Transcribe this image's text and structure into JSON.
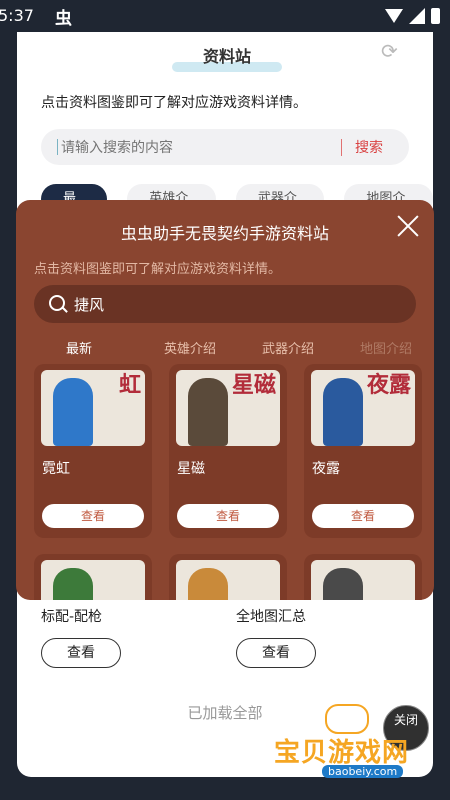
{
  "status": {
    "time": "5:37",
    "notif": "虫"
  },
  "page": {
    "title": "资料站",
    "desc": "点击资料图鉴即可了解对应游戏资料详情。",
    "search_placeholder": "请输入搜索的内容",
    "search_btn": "搜索",
    "tabs": [
      "最新",
      "英雄介绍",
      "武器介绍",
      "地图介绍"
    ],
    "bottom_items": [
      {
        "label": "标配-配枪",
        "btn": "查看"
      },
      {
        "label": "全地图汇总",
        "btn": "查看"
      }
    ],
    "loaded": "已加载全部"
  },
  "modal": {
    "title": "虫虫助手无畏契约手游资料站",
    "desc": "点击资料图鉴即可了解对应游戏资料详情。",
    "query": "捷风",
    "tabs": [
      "最新",
      "英雄介绍",
      "武器介绍",
      "地图介绍"
    ],
    "cards": [
      {
        "name": "霓虹",
        "art_text": "虹",
        "view": "查看",
        "color": "#2f78c9"
      },
      {
        "name": "星磁",
        "art_text": "星磁",
        "view": "查看",
        "color": "#5a4a3a"
      },
      {
        "name": "夜露",
        "art_text": "夜露",
        "view": "查看",
        "color": "#2a5a9e"
      }
    ]
  },
  "float_close": "关闭",
  "watermark": {
    "text": "宝贝游戏网",
    "url": "baobeiy.com"
  }
}
